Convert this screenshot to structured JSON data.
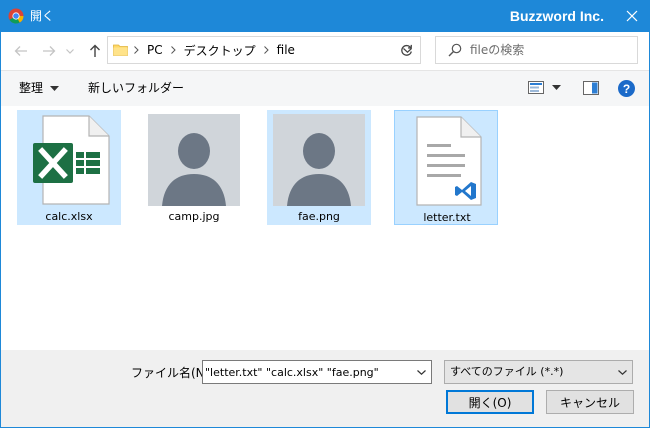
{
  "window": {
    "title": "開く",
    "app_name": "Buzzword Inc."
  },
  "navigation": {
    "breadcrumbs": [
      "PC",
      "デスクトップ",
      "file"
    ],
    "search_placeholder": "fileの検索"
  },
  "toolbar": {
    "organize_label": "整理",
    "new_folder_label": "新しいフォルダー"
  },
  "files": [
    {
      "name": "calc.xlsx",
      "type": "excel-icon",
      "selected": true
    },
    {
      "name": "camp.jpg",
      "type": "image-placeholder-icon",
      "selected": false
    },
    {
      "name": "fae.png",
      "type": "image-placeholder-icon",
      "selected": true
    },
    {
      "name": "letter.txt",
      "type": "text-file-icon",
      "selected": true
    }
  ],
  "footer": {
    "filename_label": "ファイル名(N):",
    "filename_value": "\"letter.txt\" \"calc.xlsx\" \"fae.png\"",
    "filetype_value": "すべてのファイル (*.*)",
    "open_label": "開く(O)",
    "cancel_label": "キャンセル"
  },
  "colors": {
    "title_bar": "#1e88d8",
    "selection": "#cce8ff",
    "excel_green": "#1d7044",
    "avatar_bg": "#d0d5da",
    "avatar_fg": "#6c7785",
    "vscode_blue": "#2277cc"
  }
}
